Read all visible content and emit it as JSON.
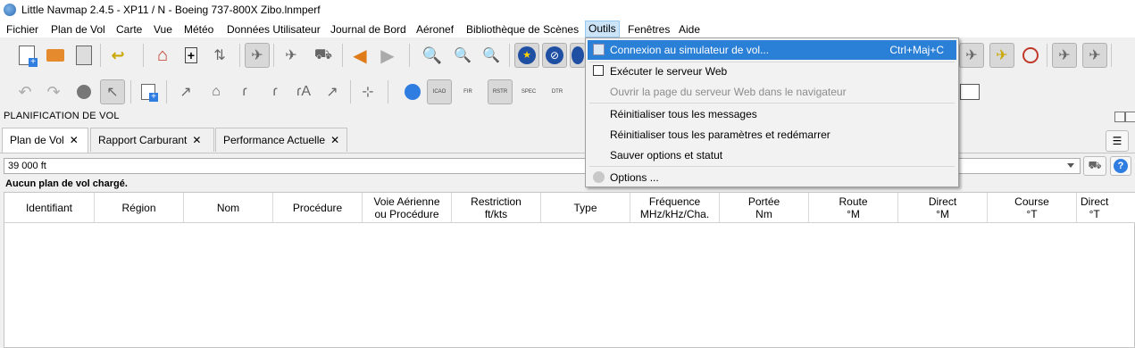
{
  "window": {
    "title": "Little Navmap 2.4.5 - XP11 / N - Boeing 737-800X Zibo.lnmperf"
  },
  "menubar": [
    {
      "label": "Fichier"
    },
    {
      "label": "Plan de Vol"
    },
    {
      "label": "Carte"
    },
    {
      "label": "Vue"
    },
    {
      "label": "Météo"
    },
    {
      "label": "Données Utilisateur"
    },
    {
      "label": "Journal de Bord"
    },
    {
      "label": "Aéronef"
    },
    {
      "label": "Bibliothèque de Scènes"
    },
    {
      "label": "Outils"
    },
    {
      "label": "Fenêtres"
    },
    {
      "label": "Aide"
    }
  ],
  "tools_menu": {
    "items": [
      {
        "label": "Connexion au simulateur de vol...",
        "shortcut": "Ctrl+Maj+C",
        "highlighted": true
      },
      {
        "label": "Exécuter le serveur Web",
        "checkbox": true
      },
      {
        "label": "Ouvrir la page du serveur Web dans le navigateur",
        "disabled": true
      },
      {
        "label": "Réinitialiser tous les messages"
      },
      {
        "label": "Réinitialiser tous les paramètres et redémarrer"
      },
      {
        "label": "Sauver options et statut"
      },
      {
        "label": "Options ..."
      }
    ]
  },
  "panel": {
    "title": "PLANIFICATION DE VOL",
    "tabs": [
      {
        "label": "Plan de Vol"
      },
      {
        "label": "Rapport Carburant"
      },
      {
        "label": "Performance Actuelle"
      }
    ],
    "altitude": "39 000 ft",
    "status": "Aucun plan de vol chargé."
  },
  "table": {
    "columns": [
      {
        "line1": "Identifiant",
        "line2": ""
      },
      {
        "line1": "Région",
        "line2": ""
      },
      {
        "line1": "Nom",
        "line2": ""
      },
      {
        "line1": "Procédure",
        "line2": ""
      },
      {
        "line1": "Voie Aérienne",
        "line2": "ou Procédure"
      },
      {
        "line1": "Restriction",
        "line2": "ft/kts"
      },
      {
        "line1": "Type",
        "line2": ""
      },
      {
        "line1": "Fréquence",
        "line2": "MHz/kHz/Cha."
      },
      {
        "line1": "Portée",
        "line2": "Nm"
      },
      {
        "line1": "Route",
        "line2": "°M"
      },
      {
        "line1": "Direct",
        "line2": "°M"
      },
      {
        "line1": "Course",
        "line2": "°T"
      },
      {
        "line1": "Direct",
        "line2": "°T"
      }
    ]
  },
  "toolbar_icons": {
    "row1": [
      "new-flightplan-icon",
      "open-flightplan-icon",
      "save-flightplan-icon",
      "undo-arrow-icon",
      "home-icon",
      "add-waypoint-icon",
      "reverse-route-icon",
      "show-route-icon",
      "aircraft-trail-icon",
      "departure-icon",
      "back-icon",
      "forward-icon",
      "zoom-in-icon",
      "zoom-out-icon",
      "zoom-fit-icon",
      "airport-star-icon",
      "no-entry-icon"
    ],
    "row2": [
      "undo-icon",
      "redo-icon",
      "zoom-gauge-icon",
      "pointer-icon",
      "calc-route-icon",
      "route-1-icon",
      "route-2-icon",
      "route-3-icon",
      "route-4-icon",
      "route-5-icon",
      "route-6-icon",
      "crosshair-icon",
      "compass-icon",
      "icao-icon",
      "fir-icon",
      "rstr-icon",
      "spec-icon",
      "dtr-icon"
    ],
    "right_row1": [
      "airspace-icon",
      "aircraft-icon",
      "aircraft-yellow-icon",
      "target-icon",
      "airport-a-icon",
      "airport-a2-icon"
    ]
  },
  "icon_texts": {
    "icao": "ICAO",
    "fir": "FIR",
    "rstr": "RSTR",
    "spec": "SPEC",
    "dtr": "DTR"
  }
}
